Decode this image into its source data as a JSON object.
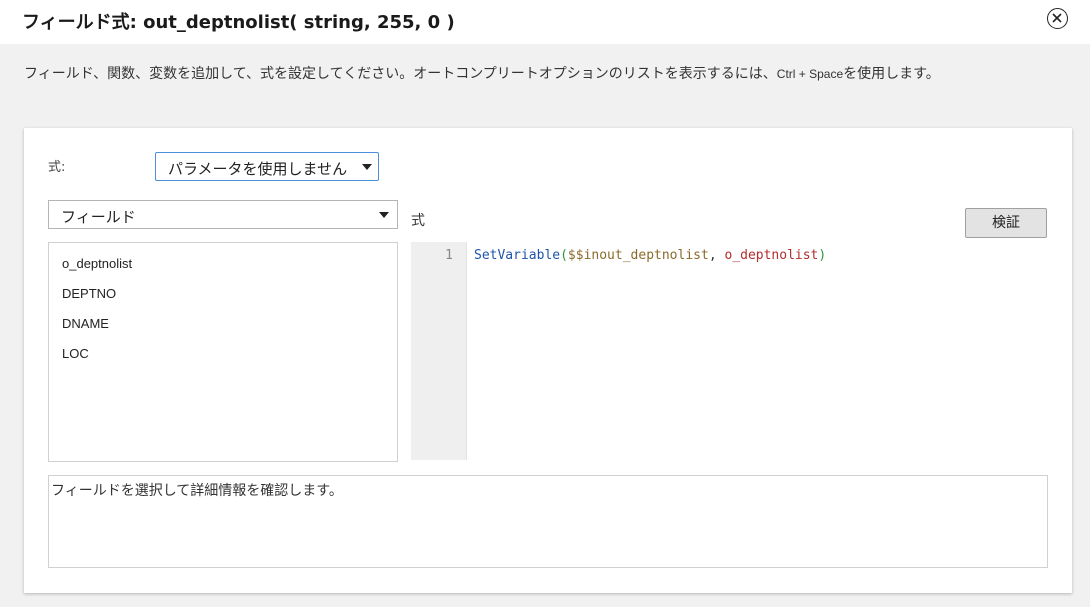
{
  "dialog": {
    "title": "フィールド式: out_deptnolist( string, 255, 0 )",
    "description_main": "フィールド、関数、変数を追加して、式を設定してください。オートコンプリートオプションのリストを表示するには、",
    "description_shortcut": "Ctrl + Space",
    "description_end": "を使用します。"
  },
  "form": {
    "expression_label": "式:",
    "parameter_select_value": "パラメータを使用しません"
  },
  "fields": {
    "filter_value": "フィールド",
    "items": [
      "o_deptnolist",
      "DEPTNO",
      "DNAME",
      "LOC"
    ]
  },
  "editor": {
    "caption": "式",
    "validate_label": "検証",
    "line_numbers": [
      "1"
    ],
    "code": {
      "function": "SetVariable",
      "open_paren": "(",
      "variable": "$$inout_deptnolist",
      "separator": ", ",
      "field": "o_deptnolist",
      "close_paren": ")"
    }
  },
  "details": {
    "placeholder": "フィールドを選択して詳細情報を確認します。"
  },
  "icons": {
    "close": "close-circle-icon",
    "dropdown": "caret-down-icon"
  },
  "colors": {
    "function": "#1f55a8",
    "paren": "#2a9a3a",
    "variable": "#8a6a2a",
    "field": "#b32d2d"
  }
}
